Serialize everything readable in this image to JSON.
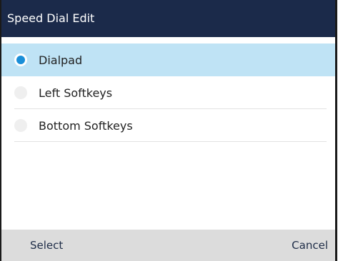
{
  "header": {
    "title": "Speed Dial Edit"
  },
  "options": [
    {
      "label": "Dialpad",
      "selected": true
    },
    {
      "label": "Left Softkeys",
      "selected": false
    },
    {
      "label": "Bottom Softkeys",
      "selected": false
    }
  ],
  "softkeys": {
    "left_label": "Select",
    "right_label": "Cancel"
  },
  "colors": {
    "title_bar": "#1b2a4a",
    "selected_row": "#bfe3f5",
    "radio_selected": "#1b8fd8",
    "softkey_bar": "#dcdcdc"
  }
}
